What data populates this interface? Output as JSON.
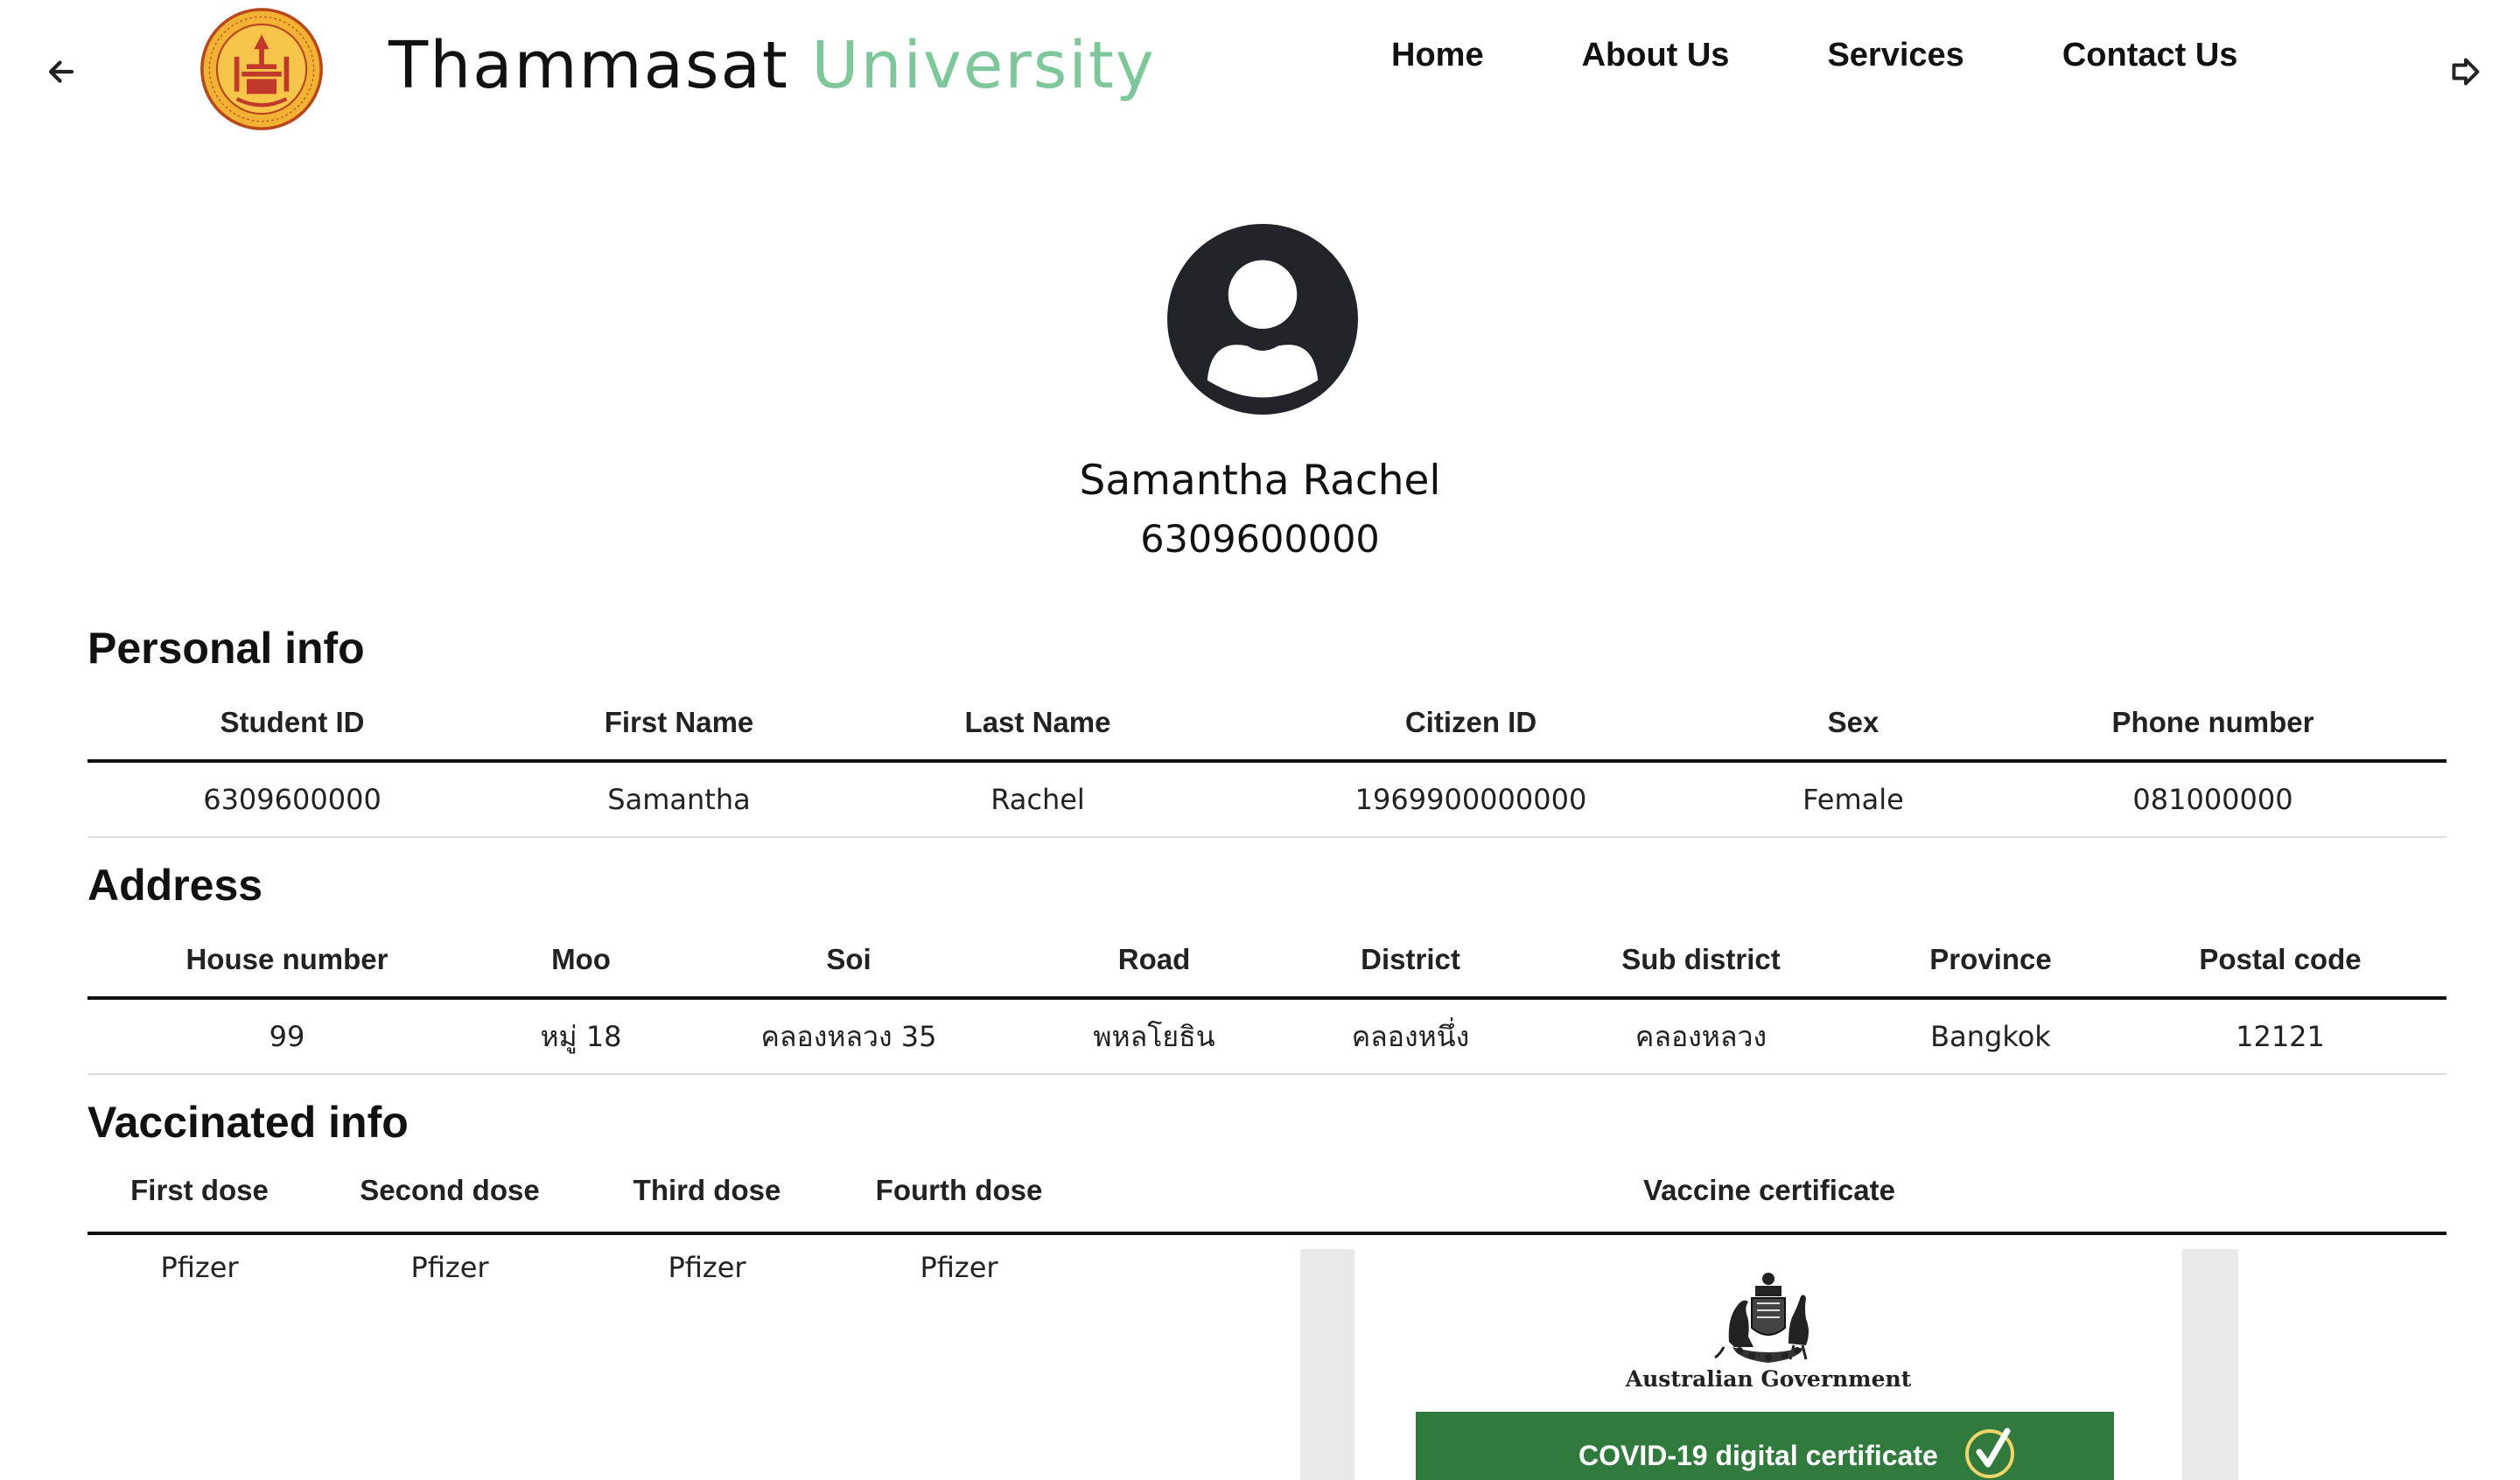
{
  "header": {
    "brand_main": "Thammasat",
    "brand_accent": "University",
    "logo_label": "Thammasat University seal",
    "back_icon": "arrow-left-icon",
    "logout_icon": "sign-out-icon",
    "accent_color": "#7ec79a",
    "nav": [
      "Home",
      "About Us",
      "Services",
      "Contact Us"
    ]
  },
  "profile": {
    "avatar_icon": "user-circle-icon",
    "name": "Samantha Rachel",
    "id": "6309600000"
  },
  "personal": {
    "title": "Personal info",
    "headers": [
      "Student ID",
      "First Name",
      "Last Name",
      "Citizen ID",
      "Sex",
      "Phone number"
    ],
    "values": [
      "6309600000",
      "Samantha",
      "Rachel",
      "1969900000000",
      "Female",
      "081000000"
    ]
  },
  "address": {
    "title": "Address",
    "headers": [
      "House number",
      "Moo",
      "Soi",
      "Road",
      "District",
      "Sub district",
      "Province",
      "Postal code"
    ],
    "values": [
      "99",
      "หมู่ 18",
      "คลองหลวง 35",
      "พหลโยธิน",
      "คลองหนึ่ง",
      "คลองหลวง",
      "Bangkok",
      "12121"
    ]
  },
  "vaccine": {
    "title": "Vaccinated info",
    "headers": [
      "First dose",
      "Second dose",
      "Third dose",
      "Fourth dose",
      "Vaccine certificate"
    ],
    "values": [
      "Pfizer",
      "Pfizer",
      "Pfizer",
      "Pfizer"
    ],
    "certificate": {
      "gov_text": "Australian Government",
      "banner_text": "COVID-19 digital certificate",
      "banner_color": "#2f7a3c"
    }
  }
}
